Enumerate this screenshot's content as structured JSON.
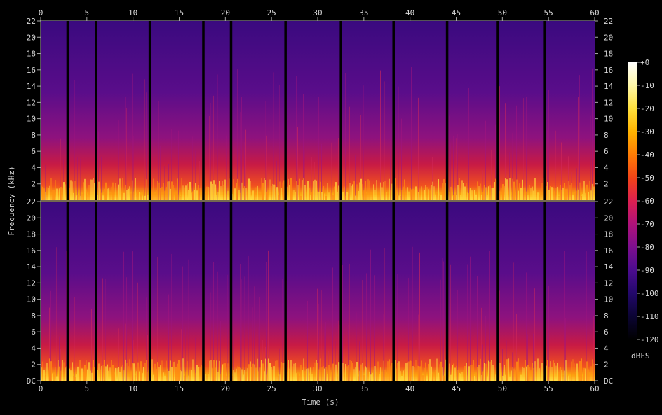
{
  "chart_data": {
    "type": "heatmap",
    "title": "",
    "xlabel": "Time (s)",
    "ylabel": "Frequency (kHz)",
    "xlim": [
      0,
      60
    ],
    "ylim": [
      0,
      22
    ],
    "x_ticks": [
      "0",
      "5",
      "10",
      "15",
      "20",
      "25",
      "30",
      "35",
      "40",
      "45",
      "50",
      "55",
      "60"
    ],
    "y_ticks_upper": [
      "22",
      "20",
      "18",
      "16",
      "14",
      "12",
      "10",
      "8",
      "6",
      "4",
      "2"
    ],
    "y_ticks_lower": [
      "22",
      "20",
      "18",
      "16",
      "14",
      "12",
      "10",
      "8",
      "6",
      "4",
      "2",
      "DC"
    ],
    "channels": 2,
    "colorbar": {
      "label": "dBFS",
      "range": [
        -120,
        0
      ],
      "ticks": [
        "+0",
        "-10",
        "-20",
        "-30",
        "-40",
        "-50",
        "-60",
        "-70",
        "-80",
        "-90",
        "-100",
        "-110",
        "-120"
      ],
      "colors": [
        "#000000",
        "#0b0433",
        "#23086b",
        "#4b0c8f",
        "#7d0f8f",
        "#b0127a",
        "#dc2050",
        "#f34418",
        "#fd7c05",
        "#ffb300",
        "#ffe03c",
        "#fff8a8",
        "#ffffff"
      ]
    },
    "silent_gaps_s": [
      2.9,
      6.0,
      11.8,
      17.6,
      20.6,
      26.5,
      32.5,
      38.2,
      44.0,
      49.5,
      54.6
    ]
  }
}
